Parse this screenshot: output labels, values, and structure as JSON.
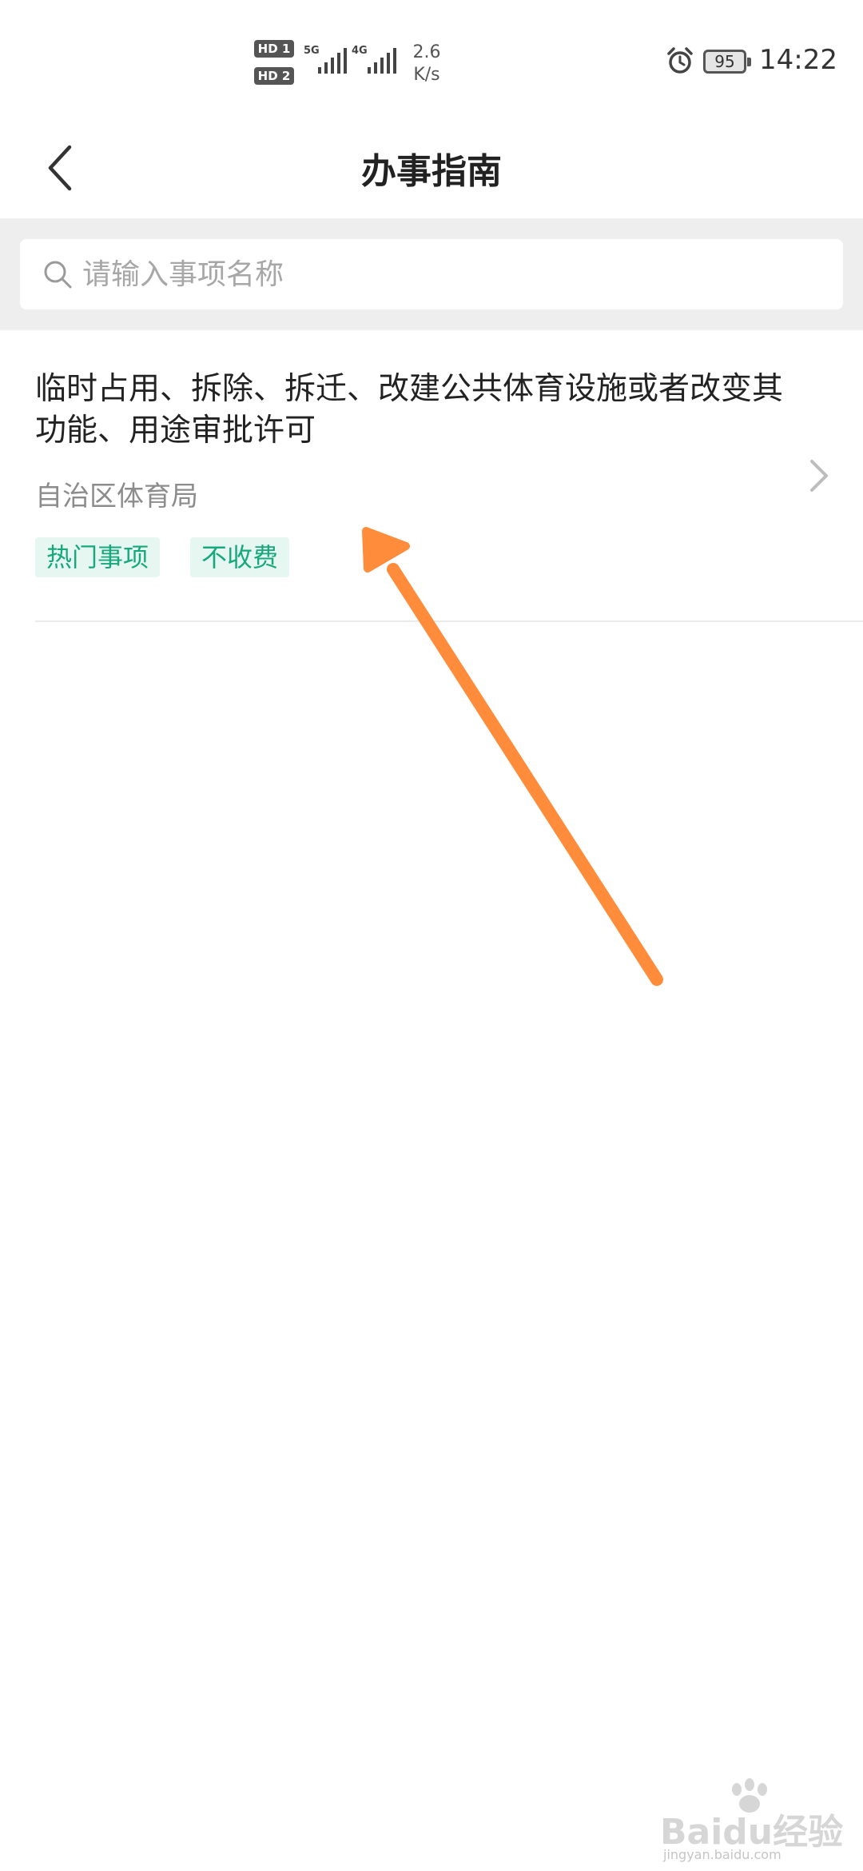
{
  "status_bar": {
    "hd1": "HD 1",
    "hd2": "HD 2",
    "net1": "5G",
    "net2": "4G",
    "speed_value": "2.6",
    "speed_unit": "K/s",
    "battery": "95",
    "time": "14:22",
    "icons": [
      "alarm-icon",
      "battery-icon",
      "signal-icon"
    ]
  },
  "nav": {
    "title": "办事指南",
    "back_icon": "chevron-left-icon"
  },
  "search": {
    "placeholder": "请输入事项名称",
    "value": "",
    "icon": "search-icon"
  },
  "items": [
    {
      "title": "临时占用、拆除、拆迁、改建公共体育设施或者改变其功能、用途审批许可",
      "department": "自治区体育局",
      "tags": [
        "热门事项",
        "不收费"
      ]
    }
  ],
  "colors": {
    "tag_text": "#17a97b",
    "tag_bg": "#e6f7f1",
    "annotation_arrow": "#ff8c3a",
    "search_bg": "#eeeeee"
  },
  "watermark": {
    "logo": "Baidu经验",
    "sub": "jingyan.baidu.com"
  }
}
